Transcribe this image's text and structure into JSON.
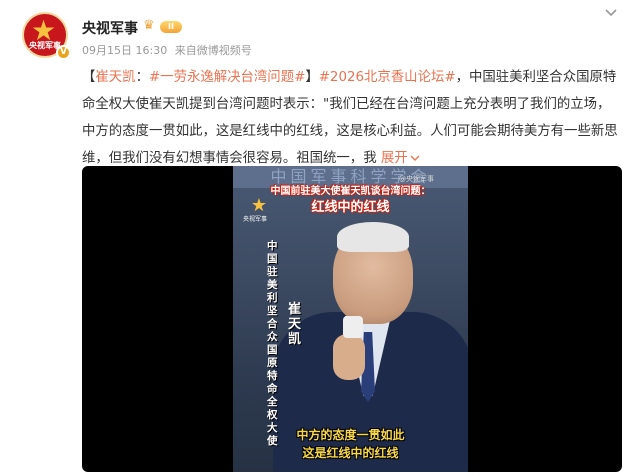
{
  "account": {
    "name": "央视军事",
    "avatar_text": "央视军事",
    "level": "II",
    "vip_icon": "crown-icon",
    "verified_icon": "verified-v-icon"
  },
  "meta": {
    "date": "09月15日 16:30",
    "source_prefix": "来自",
    "source": "微博视频号"
  },
  "post": {
    "bracket_open": "【",
    "author_tag": "崔天凯",
    "colon": "：",
    "topic1": "#一劳永逸解决台湾问题#",
    "bracket_close": "】",
    "topic2": "#2026北京香山论坛#",
    "body": "，中国驻美利坚合众国原特命全权大使崔天凯提到台湾问题时表示：\"我们已经在台湾问题上充分表明了我们的立场，中方的态度一贯如此，这是红线中的红线，这是核心利益。人们可能会期待美方有一些新思维，但我们没有幻想事情会很容易。祖国统一，我",
    "expand_label": "展开",
    "expand_icon": "chevron-down-icon"
  },
  "video": {
    "banner": "中国军事科学学会",
    "channel_logo_sub": "央视军事",
    "watermark": "@央视军事",
    "title_top": "中国前驻美大使崔天凯谈台湾问题：",
    "title_main": "红线中的红线",
    "vertical_title": "中国驻美利坚合众国原特命全权大使",
    "vertical_name": "崔天凯",
    "subtitle1": "中方的态度一贯如此",
    "subtitle2": "这是红线中的红线"
  },
  "colors": {
    "link": "#eb7350",
    "subtitle": "#f7d64a",
    "avatar_bg": "#c8161d"
  }
}
